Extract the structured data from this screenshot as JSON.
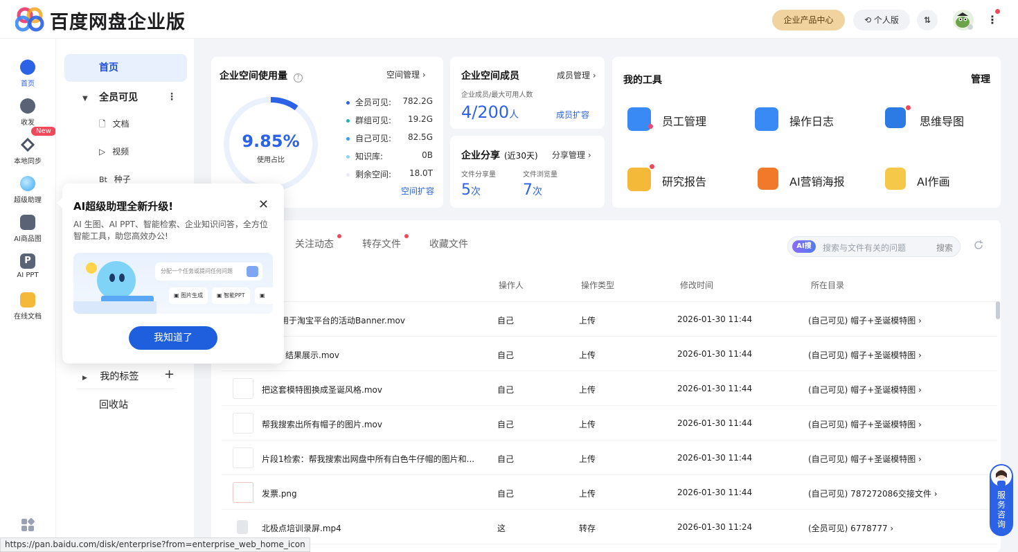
{
  "header": {
    "brand": "百度网盘企业版",
    "product_center": "企业产品中心",
    "personal": "个人版",
    "transfer": "⇅"
  },
  "rail": [
    {
      "label": "首页",
      "icon": "home-icon"
    },
    {
      "label": "收发",
      "icon": "transfer-icon"
    },
    {
      "label": "本地同步",
      "icon": "sync-icon"
    },
    {
      "label": "超级助理",
      "icon": "assistant-icon"
    },
    {
      "label": "AI商品图",
      "icon": "ai-product-icon"
    },
    {
      "label": "AI PPT",
      "icon": "ai-ppt-icon"
    },
    {
      "label": "在线文档",
      "icon": "online-doc-icon"
    }
  ],
  "rail_new_badge": "New",
  "nav": {
    "home": "首页",
    "all_visible": "全员可见",
    "docs": "文档",
    "videos": "视频",
    "torrents": "种子",
    "torrent_prefix": "Bt",
    "my_tags": "我的标签",
    "recycle": "回收站"
  },
  "usage": {
    "title": "企业空间使用量",
    "manage": "空间管理",
    "percent": "9.85%",
    "percent_label": "使用占比",
    "percent_value": 0.0985,
    "items": [
      {
        "label": "全员可见:",
        "value": "782.2G",
        "color": "#2c62e6"
      },
      {
        "label": "群组可见:",
        "value": "19.2G",
        "color": "#21b3a8"
      },
      {
        "label": "自己可见:",
        "value": "82.5G",
        "color": "#3a9af5"
      },
      {
        "label": "知识库:",
        "value": "0B",
        "color": "#8fd3f5"
      },
      {
        "label": "剩余空间:",
        "value": "18.0T",
        "color": "#e8ecf2"
      }
    ],
    "expand": "空间扩容"
  },
  "members": {
    "title": "企业空间成员",
    "manage": "成员管理",
    "subtitle": "企业成员/最大可用人数",
    "count": "4/200",
    "unit": "人",
    "expand": "成员扩容"
  },
  "share": {
    "title": "企业分享",
    "period": "(近30天)",
    "manage": "分享管理",
    "file_share_label": "文件分享量",
    "file_share_value": "5",
    "file_view_label": "文件浏览量",
    "file_view_value": "7",
    "unit": "次"
  },
  "tools": {
    "title": "我的工具",
    "manage": "管理",
    "items": [
      {
        "label": "员工管理",
        "icon": "employee-icon",
        "color": "#3a8af5"
      },
      {
        "label": "操作日志",
        "icon": "log-icon",
        "color": "#3a8af5"
      },
      {
        "label": "思维导图",
        "icon": "mindmap-icon",
        "color": "#2c7be5"
      },
      {
        "label": "研究报告",
        "icon": "report-icon",
        "color": "#f5b93a"
      },
      {
        "label": "AI营销海报",
        "icon": "poster-icon",
        "color": "#f07a2a"
      },
      {
        "label": "AI作画",
        "icon": "paint-icon",
        "color": "#f5c84a"
      }
    ]
  },
  "tabs": [
    "关注动态",
    "转存文件",
    "收藏文件"
  ],
  "search": {
    "ai_tag": "AI搜",
    "placeholder": "搜索与文件有关的问题",
    "button": "搜索"
  },
  "table": {
    "headers": [
      "操作人",
      "操作类型",
      "修改时间",
      "所在目录"
    ],
    "rows": [
      {
        "name": "张适用于淘宝平台的活动Banner.mov",
        "operator": "自己",
        "type": "上传",
        "time": "2026-01-30 11:44",
        "dir": "(自己可见) 帽子+圣诞模特图 ›"
      },
      {
        "name": "：结果展示.mov",
        "operator": "自己",
        "type": "上传",
        "time": "2026-01-30 11:44",
        "dir": "(自己可见) 帽子+圣诞模特图 ›"
      },
      {
        "name": "把这套模特图换成圣诞风格.mov",
        "operator": "自己",
        "type": "上传",
        "time": "2026-01-30 11:44",
        "dir": "(自己可见) 帽子+圣诞模特图 ›"
      },
      {
        "name": "帮我搜索出所有帽子的图片.mov",
        "operator": "自己",
        "type": "上传",
        "time": "2026-01-30 11:44",
        "dir": "(自己可见) 帽子+圣诞模特图 ›"
      },
      {
        "name": "片段1检索：帮我搜索出网盘中所有白色牛仔帽的图片和...",
        "operator": "自己",
        "type": "上传",
        "time": "2026-01-30 11:44",
        "dir": "(自己可见) 帽子+圣诞模特图 ›"
      },
      {
        "name": "发票.png",
        "operator": "自己",
        "type": "上传",
        "time": "2026-01-30 11:44",
        "dir": "(自己可见) 787272086交接文件 ›"
      },
      {
        "name": "北极点培训录屏.mp4",
        "operator": "这",
        "type": "转存",
        "time": "2026-01-30 11:24",
        "dir": "(全员可见) 6778777 ›"
      }
    ]
  },
  "popup": {
    "title": "AI超级助理全新升级!",
    "desc": "AI 生图、AI PPT、智能检索、企业知识问答，全方位智能工具，助您高效办公!",
    "input_placeholder": "分配一个任务或提问任何问题",
    "chip1": "图片生成",
    "chip2": "智能PPT",
    "button": "我知道了"
  },
  "status_url": "https://pan.baidu.com/disk/enterprise?from=enterprise_web_home_icon",
  "service": "服务咨询"
}
